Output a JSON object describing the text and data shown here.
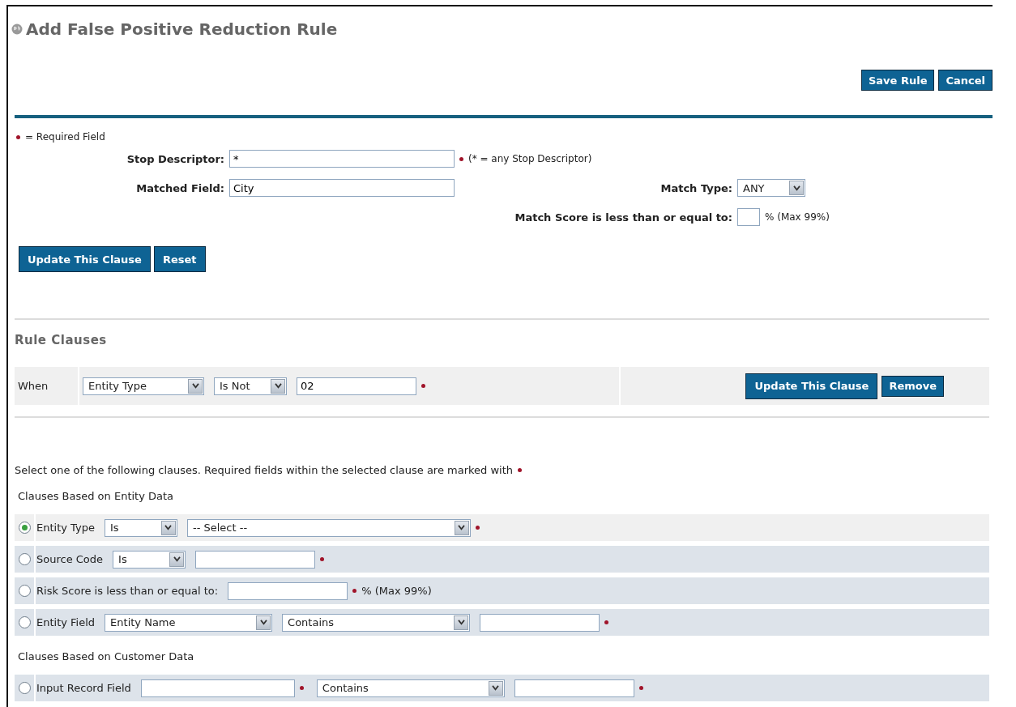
{
  "page": {
    "title": "Add False Positive Reduction Rule"
  },
  "actions": [
    "Save Rule",
    "Cancel"
  ],
  "required_note": "= Required Field",
  "form": {
    "stop_descriptor": {
      "label": "Stop Descriptor:",
      "value": "*",
      "required": true,
      "hint": "(* = any Stop Descriptor)"
    },
    "matched_field": {
      "label": "Matched Field:",
      "value": "City"
    },
    "match_type": {
      "label": "Match Type:",
      "value": "ANY"
    },
    "match_score": {
      "label": "Match Score is less than or equal to:",
      "suffix": "% (Max 99%)"
    }
  },
  "form_buttons": [
    "Update This Clause",
    "Reset"
  ],
  "rule_clauses": {
    "title": "Rule Clauses",
    "rows": [
      {
        "when": "When",
        "field": "Entity Type",
        "operator": "Is Not",
        "value": "02",
        "required": true,
        "buttons": [
          "Update This Clause",
          "Remove"
        ]
      }
    ]
  },
  "instructions": "Select one of the following clauses. Required fields within the selected clause are marked with",
  "groups": [
    {
      "title": "Clauses Based on Entity Data",
      "clauses": [
        {
          "kind": "select-select",
          "selected": true,
          "label": "Entity Type",
          "operator": "Is",
          "value": "-- Select --",
          "required": true
        },
        {
          "kind": "select-input",
          "selected": false,
          "label": "Source Code",
          "operator": "Is",
          "required": true
        },
        {
          "kind": "input-suffix",
          "selected": false,
          "label": "Risk Score is less than or equal to:",
          "required": true,
          "suffix": "% (Max 99%)"
        },
        {
          "kind": "select-select-input",
          "selected": false,
          "label": "Entity Field",
          "field": "Entity Name",
          "operator": "Contains",
          "required": true
        }
      ]
    },
    {
      "title": "Clauses Based on Customer Data",
      "clauses": [
        {
          "kind": "input-select-input",
          "selected": false,
          "label": "Input Record Field",
          "operator": "Contains",
          "required": true
        }
      ]
    }
  ]
}
